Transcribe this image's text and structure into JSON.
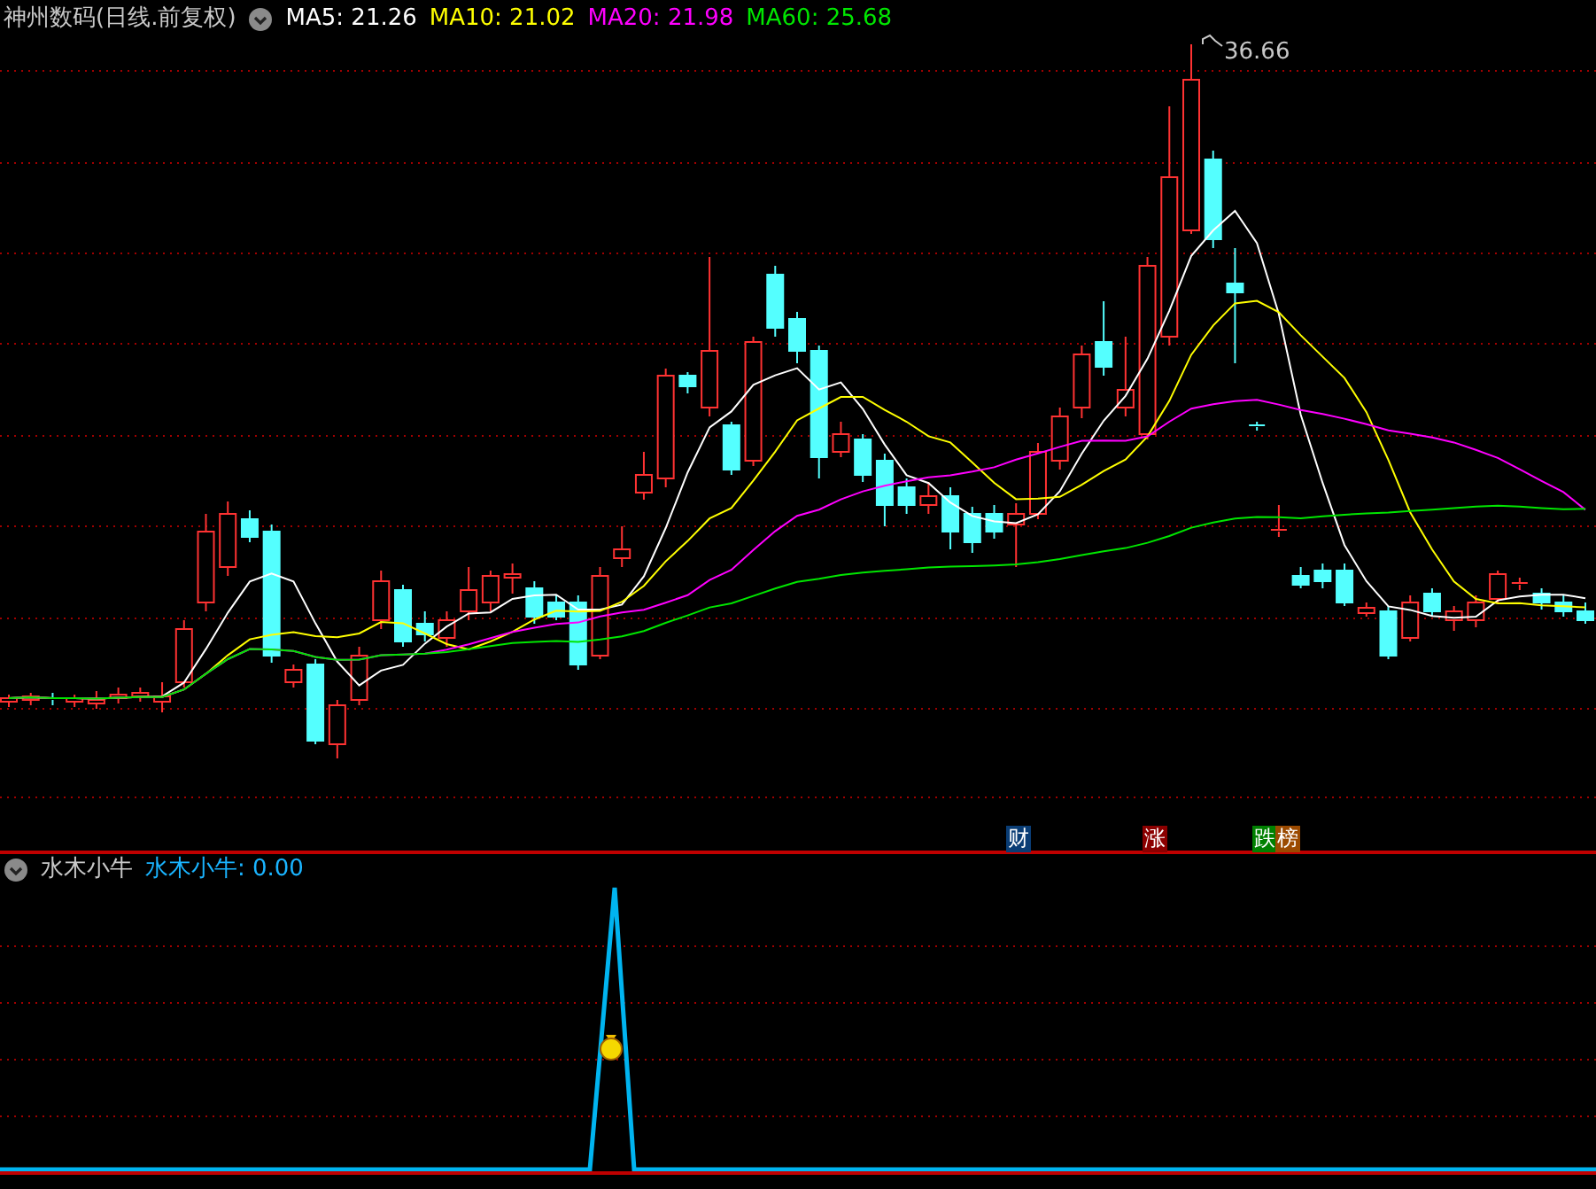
{
  "price_panel": {
    "title": "神州数码(日线.前复权)",
    "ma_legend": [
      {
        "label": "MA5: 21.26",
        "color": "#ffffff"
      },
      {
        "label": "MA10: 21.02",
        "color": "#ffff00"
      },
      {
        "label": "MA20: 21.98",
        "color": "#ff00ff"
      },
      {
        "label": "MA60: 25.68",
        "color": "#00e600"
      }
    ],
    "high_label": "36.66",
    "markers": [
      {
        "text": "财",
        "color": "#0a3d75"
      },
      {
        "text": "涨",
        "color": "#8b0000"
      },
      {
        "text": "跌",
        "color": "#008000"
      },
      {
        "text": "榜",
        "color": "#9b4a00"
      }
    ]
  },
  "indicator_panel": {
    "title": "水木小牛",
    "legend": "水木小牛: 0.00"
  }
}
